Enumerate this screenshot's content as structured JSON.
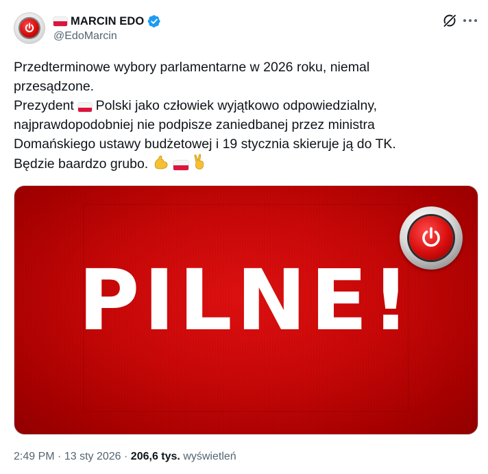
{
  "author": {
    "display_name": "MARCIN EDO",
    "handle": "@EdoMarcin",
    "verified": true,
    "flag": "poland-flag",
    "avatar": "red-power-button-icon"
  },
  "tweet": {
    "lines": [
      "Przedterminowe wybory parlamentarne w 2026 roku, niemal",
      "przesądzone.",
      "Polski jako człowiek wyjątkowo odpowiedzialny,",
      "najprawdopodobniej nie podpisze zaniedbanej przez ministra",
      "Domańskiego ustawy budżetowej i 19 stycznia skieruje ją do TK.",
      "Będzie baardzo grubo."
    ],
    "line3_prefix": "Prezydent",
    "emojis": [
      "flexed-biceps",
      "poland-flag",
      "victory-hand"
    ]
  },
  "media": {
    "headline": "PILNE!",
    "logo": "red-power-button-icon",
    "colors": {
      "background": "#c80707",
      "text": "#ffffff"
    }
  },
  "footer": {
    "time": "2:49 PM",
    "separator": "·",
    "date": "13 sty 2026",
    "views_count": "206,6 tys.",
    "views_label": "wyświetleń"
  },
  "colors": {
    "verified_badge": "#1d9bf0",
    "secondary_text": "#536471",
    "primary_text": "#0f1419",
    "flag_red": "#dc143c"
  }
}
